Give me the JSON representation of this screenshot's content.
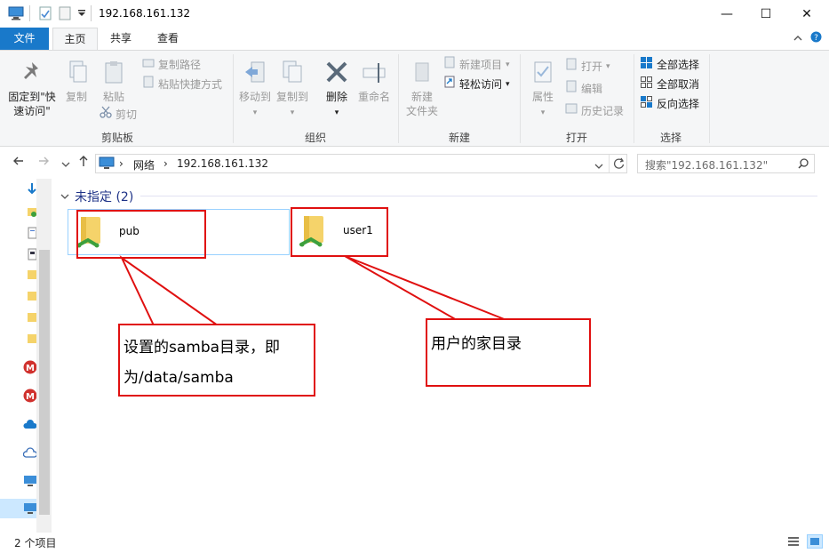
{
  "window": {
    "title": "192.168.161.132",
    "minimize": "—",
    "maximize": "☐",
    "close": "✕"
  },
  "ribbon_tabs": {
    "file": "文件",
    "home": "主页",
    "share": "共享",
    "view": "查看"
  },
  "ribbon": {
    "clipboard": {
      "label": "剪贴板",
      "pin_line1": "固定到\"快",
      "pin_line2": "速访问\"",
      "copy": "复制",
      "paste": "粘贴",
      "copy_path": "复制路径",
      "paste_shortcut": "粘贴快捷方式",
      "cut": "剪切"
    },
    "organize": {
      "label": "组织",
      "move_to": "移动到",
      "copy_to": "复制到",
      "delete": "删除",
      "rename": "重命名"
    },
    "new": {
      "label": "新建",
      "new_folder_line1": "新建",
      "new_folder_line2": "文件夹",
      "new_item": "新建项目",
      "easy_access": "轻松访问"
    },
    "open": {
      "label": "打开",
      "properties": "属性",
      "open": "打开",
      "edit": "编辑",
      "history": "历史记录"
    },
    "select": {
      "label": "选择",
      "select_all": "全部选择",
      "select_none": "全部取消",
      "invert": "反向选择"
    }
  },
  "address": {
    "segments": [
      "网络",
      "192.168.161.132"
    ],
    "search_placeholder": "搜索\"192.168.161.132\""
  },
  "content": {
    "group_header": "未指定 (2)",
    "items": [
      {
        "name": "pub"
      },
      {
        "name": "user1"
      }
    ]
  },
  "annotations": {
    "pub_note_line1": "设置的samba目录，即",
    "pub_note_line2": "为/data/samba",
    "user_note": "用户的家目录"
  },
  "status": {
    "count": "2 个项目"
  },
  "colors": {
    "accent": "#1979ca",
    "annotation": "#e01010",
    "folder": "#f5d36a",
    "share_green": "#3da03d"
  }
}
